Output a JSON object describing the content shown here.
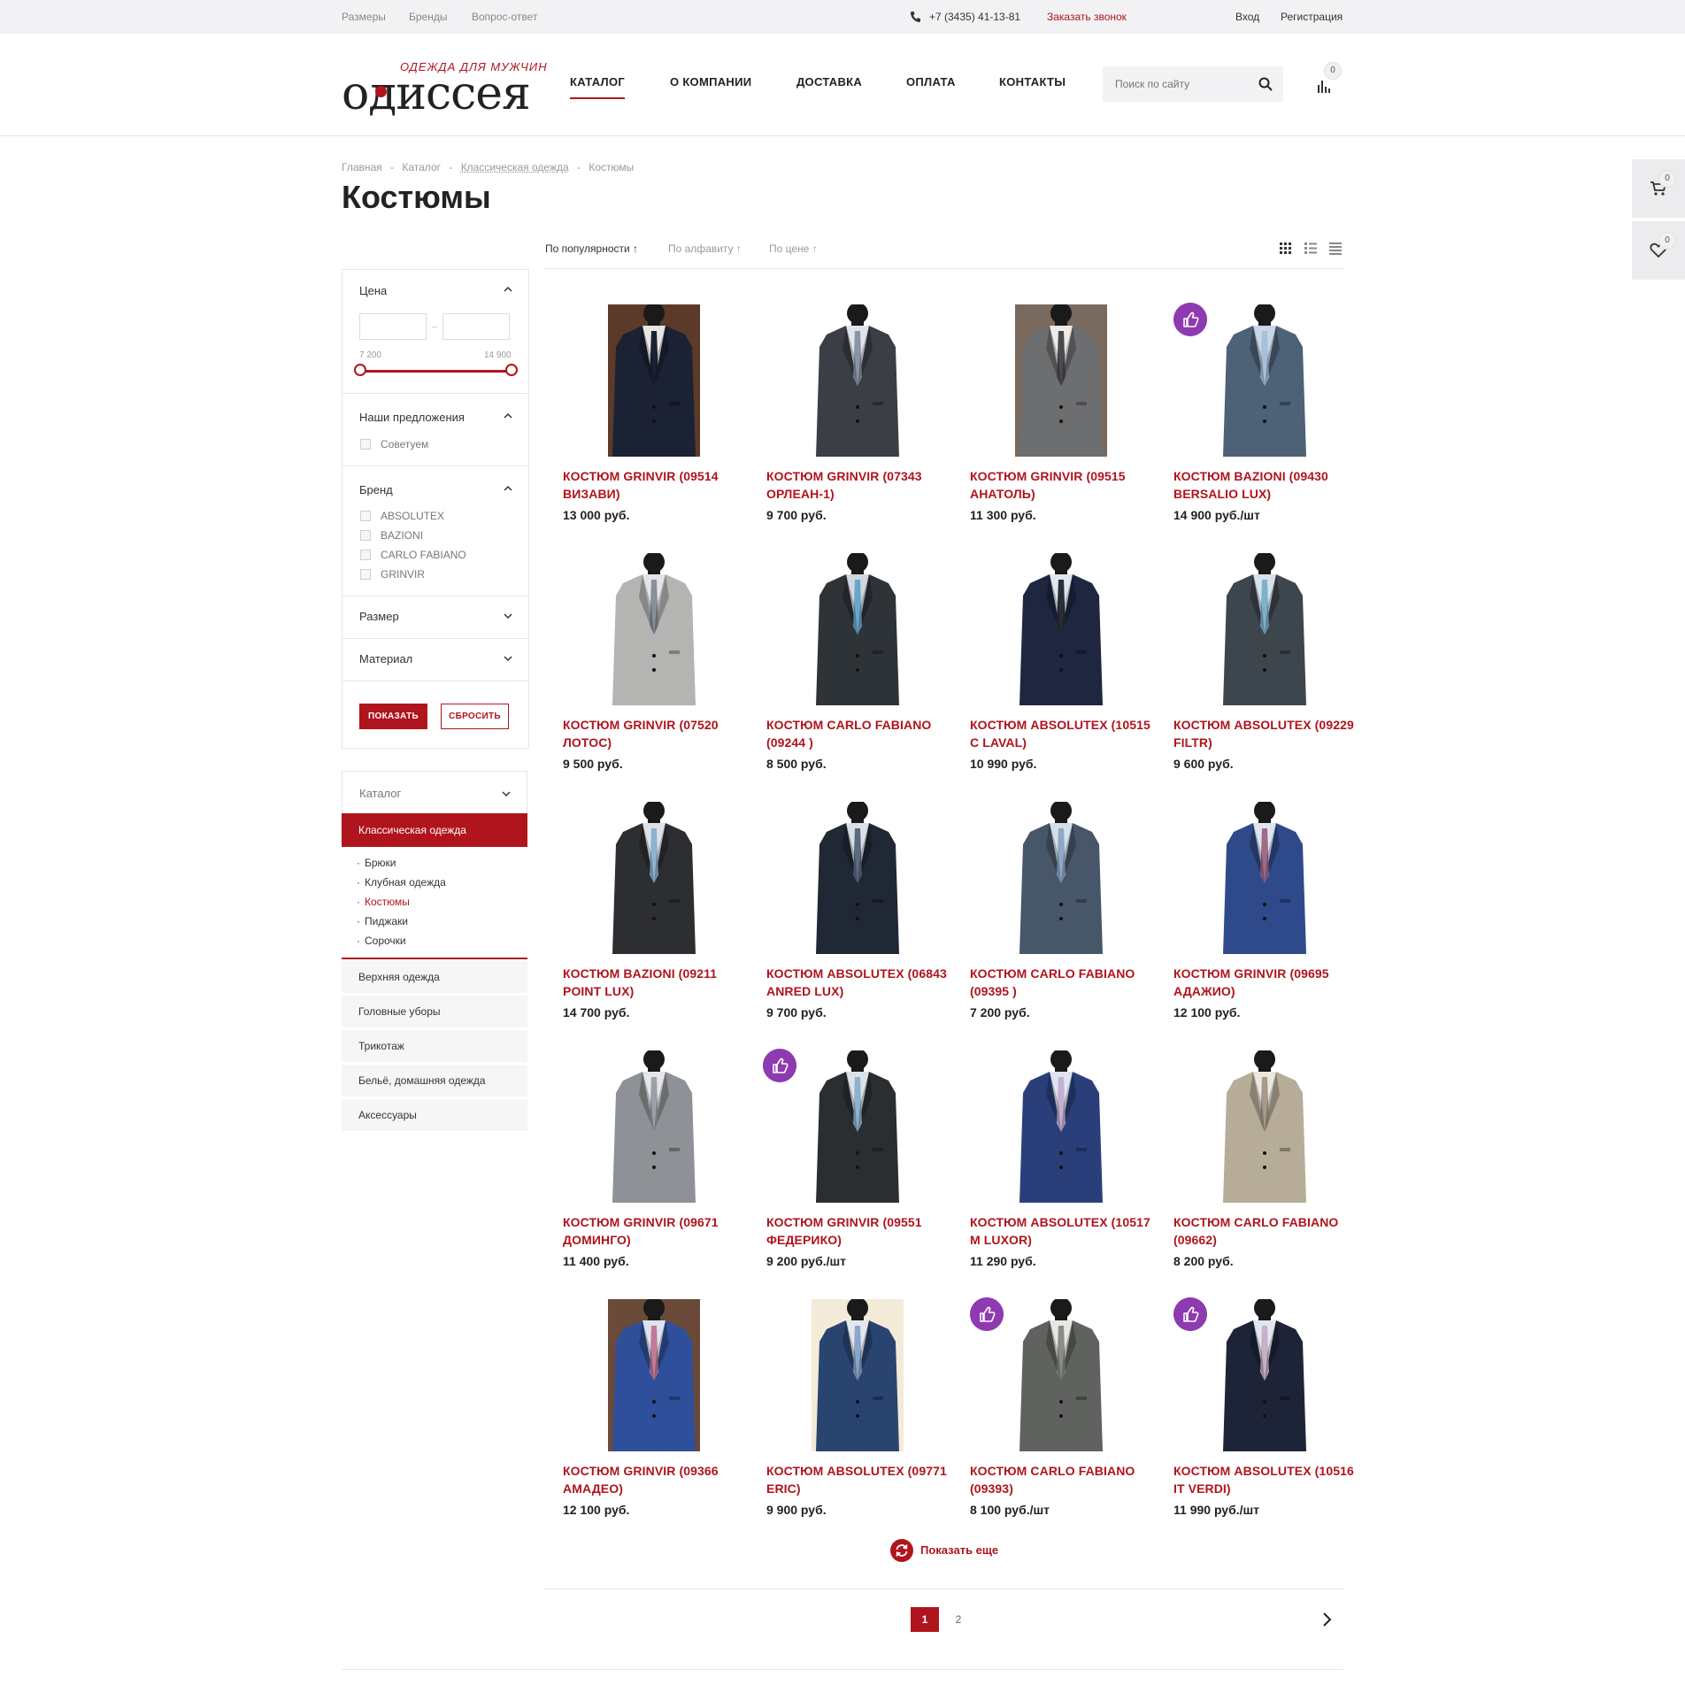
{
  "topbar": {
    "links": [
      "Размеры",
      "Бренды",
      "Вопрос-ответ"
    ],
    "phone": "+7 (3435) 41-13-81",
    "callback": "Заказать звонок",
    "login": "Вход",
    "register": "Регистрация"
  },
  "logo": {
    "tagline": "ОДЕЖДА ДЛЯ МУЖЧИН",
    "name": "одиссея"
  },
  "nav": [
    "КАТАЛОГ",
    "О КОМПАНИИ",
    "ДОСТАВКА",
    "ОПЛАТА",
    "КОНТАКТЫ"
  ],
  "search": {
    "placeholder": "Поиск по сайту"
  },
  "compare_count": "0",
  "cart_count": "0",
  "wishlist_count": "0",
  "breadcrumb": [
    "Главная",
    "-",
    "Каталог",
    "-",
    "Классическая одежда",
    "-",
    "Костюмы"
  ],
  "page_title": "Костюмы",
  "sort": [
    "По популярности ↑",
    "По алфавиту ↑",
    "По цене ↑"
  ],
  "filter": {
    "price": {
      "title": "Цена",
      "min": "7 200",
      "max": "14 900"
    },
    "offers": {
      "title": "Наши предложения",
      "options": [
        "Советуем"
      ]
    },
    "brand": {
      "title": "Бренд",
      "options": [
        "ABSOLUTEX",
        "BAZIONI",
        "CARLO FABIANO",
        "GRINVIR"
      ]
    },
    "size": {
      "title": "Размер"
    },
    "material": {
      "title": "Материал"
    },
    "show_label": "ПОКАЗАТЬ",
    "reset_label": "СБРОСИТЬ"
  },
  "catalog": {
    "title": "Каталог",
    "active": "Классическая одежда",
    "sub": [
      "Брюки",
      "Клубная одежда",
      "Костюмы",
      "Пиджаки",
      "Сорочки"
    ],
    "current_sub": "Костюмы",
    "items": [
      "Верхняя одежда",
      "Головные уборы",
      "Трикотаж",
      "Бельё, домашняя одежда",
      "Аксессуары"
    ]
  },
  "products": [
    {
      "name": "КОСТЮМ GRINVIR (09514 ВИЗАВИ)",
      "price": "13 000 руб.",
      "badge": false,
      "jacket": "#1b2233",
      "shirt": "#e9e6e2",
      "tie": "#1b2233",
      "bg": "#5c3a2a"
    },
    {
      "name": "КОСТЮМ GRINVIR (07343 ОРЛЕАН-1)",
      "price": "9 700 руб.",
      "badge": false,
      "jacket": "#3b3e44",
      "shirt": "#dfe3ea",
      "tie": "#8a94a8",
      "bg": "#ffffff"
    },
    {
      "name": "КОСТЮМ GRINVIR (09515 АНАТОЛЬ)",
      "price": "11 300 руб.",
      "badge": false,
      "jacket": "#6d6e70",
      "shirt": "#ecebe8",
      "tie": "#4a4b4e",
      "bg": "#7a6a5e"
    },
    {
      "name": "КОСТЮМ BAZIONI (09430 BERSALIO LUX)",
      "price": "14 900 руб./шт",
      "badge": true,
      "jacket": "#4d6177",
      "shirt": "#c8d6e8",
      "tie": "#a8c0da",
      "bg": "#ffffff"
    },
    {
      "name": "КОСТЮМ GRINVIR (07520 ЛОТОС)",
      "price": "9 500 руб.",
      "badge": false,
      "jacket": "#b4b4b2",
      "shirt": "#e2e4e8",
      "tie": "#8a8f98",
      "bg": "#ffffff"
    },
    {
      "name": "КОСТЮМ CARLO FABIANO (09244 )",
      "price": "8 500 руб.",
      "badge": false,
      "jacket": "#2e3338",
      "shirt": "#cfd7e2",
      "tie": "#6aa6c8",
      "bg": "#ffffff"
    },
    {
      "name": "КОСТЮМ ABSOLUTEX (10515 C LAVAL)",
      "price": "10 990 руб.",
      "badge": false,
      "jacket": "#1e2640",
      "shirt": "#dfe6ee",
      "tie": "#2a2e38",
      "bg": "#ffffff"
    },
    {
      "name": "КОСТЮМ ABSOLUTEX (09229 FILTR)",
      "price": "9 600 руб.",
      "badge": false,
      "jacket": "#3d454d",
      "shirt": "#d7e2ea",
      "tie": "#7fb0cc",
      "bg": "#ffffff"
    },
    {
      "name": "КОСТЮМ BAZIONI (09211 POINT LUX)",
      "price": "14 700 руб.",
      "badge": false,
      "jacket": "#2c2e31",
      "shirt": "#dfe3e8",
      "tie": "#8db2d2",
      "bg": "#ffffff"
    },
    {
      "name": "КОСТЮМ ABSOLUTEX (06843 ANRED LUX)",
      "price": "9 700 руб.",
      "badge": false,
      "jacket": "#1f2834",
      "shirt": "#d9e0e8",
      "tie": "#5a6a80",
      "bg": "#ffffff"
    },
    {
      "name": "КОСТЮМ CARLO FABIANO (09395 )",
      "price": "7 200 руб.",
      "badge": false,
      "jacket": "#48566a",
      "shirt": "#d5dfea",
      "tie": "#8fa8c4",
      "bg": "#ffffff"
    },
    {
      "name": "КОСТЮМ GRINVIR (09695 АДАЖИО)",
      "price": "12 100 руб.",
      "badge": false,
      "jacket": "#2f4a8a",
      "shirt": "#dfe5f0",
      "tie": "#a06a8a",
      "bg": "#ffffff"
    },
    {
      "name": "КОСТЮМ GRINVIR (09671 ДОМИНГО)",
      "price": "11 400 руб.",
      "badge": false,
      "jacket": "#8e9196",
      "shirt": "#e6e6e6",
      "tie": "#9aa0aa",
      "bg": "#ffffff"
    },
    {
      "name": "КОСТЮМ GRINVIR (09551 ФЕДЕРИКО)",
      "price": "9 200 руб./шт",
      "badge": true,
      "jacket": "#2b2e30",
      "shirt": "#dde2e8",
      "tie": "#8eb2cc",
      "bg": "#ffffff"
    },
    {
      "name": "КОСТЮМ ABSOLUTEX (10517 M LUXOR)",
      "price": "11 290 руб.",
      "badge": false,
      "jacket": "#2a3f7a",
      "shirt": "#dfe3f2",
      "tie": "#c4b0d2",
      "bg": "#ffffff"
    },
    {
      "name": "КОСТЮМ CARLO FABIANO (09662)",
      "price": "8 200 руб.",
      "badge": false,
      "jacket": "#b6ac98",
      "shirt": "#ece8e0",
      "tie": "#a89a88",
      "bg": "#ffffff"
    },
    {
      "name": "КОСТЮМ GRINVIR (09366 АМАДЕО)",
      "price": "12 100 руб.",
      "badge": false,
      "jacket": "#2f4f9a",
      "shirt": "#dfe3ee",
      "tie": "#c07a9a",
      "bg": "#6b4a3a"
    },
    {
      "name": "КОСТЮМ ABSOLUTEX (09771 ERIC)",
      "price": "9 900 руб.",
      "badge": false,
      "jacket": "#2a4470",
      "shirt": "#e4e8ee",
      "tie": "#8aa6c8",
      "bg": "#f3ead8"
    },
    {
      "name": "КОСТЮМ CARLO FABIANO (09393)",
      "price": "8 100 руб./шт",
      "badge": true,
      "jacket": "#5f625f",
      "shirt": "#e6e6e2",
      "tie": "#8a8c86",
      "bg": "#ffffff"
    },
    {
      "name": "КОСТЮМ ABSOLUTEX (10516 IT VERDI)",
      "price": "11 990 руб./шт",
      "badge": true,
      "jacket": "#1e2438",
      "shirt": "#e2e6ee",
      "tie": "#c8b0c8",
      "bg": "#ffffff"
    }
  ],
  "load_more": "Показать еще",
  "pages": [
    "1",
    "2"
  ],
  "current_page": "1",
  "colors": {
    "accent": "#b0141c",
    "badge": "#8e3ab0"
  }
}
